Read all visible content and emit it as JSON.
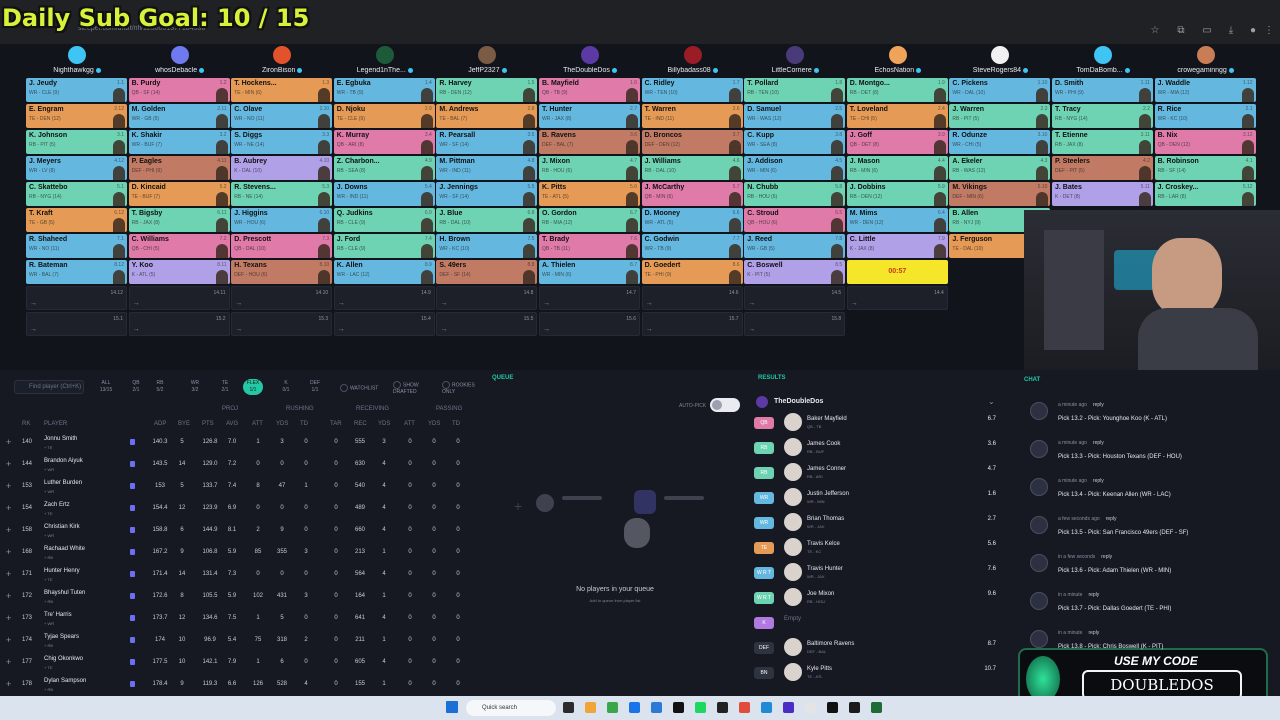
{
  "overlay": {
    "sub_goal": "Daily Sub Goal:  10 / 15"
  },
  "browser": {
    "url": "sleeper.com/draft/nfl/1250001377184536"
  },
  "teams": [
    {
      "name": "Nighthawkgg",
      "color": "#3ec5f3"
    },
    {
      "name": "whosDebacle",
      "color": "#6f79f0"
    },
    {
      "name": "ZironBison",
      "color": "#e2522b"
    },
    {
      "name": "Legend1nThe...",
      "color": "#1d5a3a"
    },
    {
      "name": "JeffP2327",
      "color": "#7a5b44"
    },
    {
      "name": "TheDoubleDos",
      "color": "#5c3aa6"
    },
    {
      "name": "Billybadass08",
      "color": "#9a1c24"
    },
    {
      "name": "LittleCorriere",
      "color": "#4a3a7a"
    },
    {
      "name": "EchosNation",
      "color": "#f0a45a"
    },
    {
      "name": "SteveRogers84",
      "color": "#f1f1f1"
    },
    {
      "name": "TomDaBomb...",
      "color": "#3ec5f3"
    },
    {
      "name": "crowegaminngg",
      "color": "#c87d55"
    }
  ],
  "board": [
    [
      [
        "J. Jeudy",
        "WR - CLE (9)",
        "1.1",
        "WR"
      ],
      [
        "B. Purdy",
        "QB - SF (14)",
        "1.2",
        "QB"
      ],
      [
        "T. Hockens...",
        "TE - MIN (6)",
        "1.3",
        "TE"
      ],
      [
        "E. Egbuka",
        "WR - TB (9)",
        "1.4",
        "WR"
      ],
      [
        "R. Harvey",
        "RB - DEN (12)",
        "1.5",
        "RB"
      ],
      [
        "B. Mayfield",
        "QB - TB (9)",
        "1.6",
        "QB"
      ],
      [
        "C. Ridley",
        "WR - TEN (10)",
        "1.7",
        "WR"
      ],
      [
        "T. Pollard",
        "RB - TEN (10)",
        "1.8",
        "RB"
      ],
      [
        "D. Montgo...",
        "RB - DET (8)",
        "1.9",
        "RB"
      ],
      [
        "C. Pickens",
        "WR - DAL (10)",
        "1.10",
        "WR"
      ],
      [
        "D. Smith",
        "WR - PHI (9)",
        "1.11",
        "WR"
      ],
      [
        "J. Waddle",
        "WR - MIA (12)",
        "1.12",
        "WR"
      ]
    ],
    [
      [
        "E. Engram",
        "TE - DEN (12)",
        "2.12",
        "TE"
      ],
      [
        "M. Golden",
        "WR - GB (5)",
        "2.11",
        "WR"
      ],
      [
        "C. Olave",
        "WR - NO (11)",
        "2.10",
        "WR"
      ],
      [
        "D. Njoku",
        "TE - CLE (9)",
        "2.9",
        "TE"
      ],
      [
        "M. Andrews",
        "TE - BAL (7)",
        "2.8",
        "TE"
      ],
      [
        "T. Hunter",
        "WR - JAX (8)",
        "2.7",
        "WR"
      ],
      [
        "T. Warren",
        "TE - IND (11)",
        "2.6",
        "TE"
      ],
      [
        "D. Samuel",
        "WR - WAS (12)",
        "2.5",
        "WR"
      ],
      [
        "T. Loveland",
        "TE - CHI (5)",
        "2.4",
        "TE"
      ],
      [
        "J. Warren",
        "RB - PIT (5)",
        "2.3",
        "RB"
      ],
      [
        "T. Tracy",
        "RB - NYG (14)",
        "2.2",
        "RB"
      ],
      [
        "R. Rice",
        "WR - KC (10)",
        "2.1",
        "WR"
      ]
    ],
    [
      [
        "K. Johnson",
        "RB - PIT (5)",
        "3.1",
        "RB"
      ],
      [
        "K. Shakir",
        "WR - BUF (7)",
        "3.2",
        "WR"
      ],
      [
        "S. Diggs",
        "WR - NE (14)",
        "3.3",
        "WR"
      ],
      [
        "K. Murray",
        "QB - ARI (8)",
        "3.4",
        "QB"
      ],
      [
        "R. Pearsall",
        "WR - SF (14)",
        "3.5",
        "WR"
      ],
      [
        "B. Ravens",
        "DEF - BAL (7)",
        "3.6",
        "DEF"
      ],
      [
        "D. Broncos",
        "DEF - DEN (12)",
        "3.7",
        "DEF"
      ],
      [
        "C. Kupp",
        "WR - SEA (8)",
        "3.8",
        "WR"
      ],
      [
        "J. Goff",
        "QB - DET (8)",
        "3.9",
        "QB"
      ],
      [
        "R. Odunze",
        "WR - CHI (5)",
        "3.10",
        "WR"
      ],
      [
        "T. Etienne",
        "RB - JAX (8)",
        "3.11",
        "RB"
      ],
      [
        "B. Nix",
        "QB - DEN (12)",
        "3.12",
        "QB"
      ]
    ],
    [
      [
        "J. Meyers",
        "WR - LV (8)",
        "4.12",
        "WR"
      ],
      [
        "P. Eagles",
        "DEF - PHI (9)",
        "4.11",
        "DEF"
      ],
      [
        "B. Aubrey",
        "K - DAL (10)",
        "4.10",
        "K"
      ],
      [
        "Z. Charbon...",
        "RB - SEA (8)",
        "4.9",
        "RB"
      ],
      [
        "M. Pittman",
        "WR - IND (11)",
        "4.8",
        "WR"
      ],
      [
        "J. Mixon",
        "RB - HOU (6)",
        "4.7",
        "RB"
      ],
      [
        "J. Williams",
        "RB - DAL (10)",
        "4.6",
        "RB"
      ],
      [
        "J. Addison",
        "WR - MIN (6)",
        "4.5",
        "WR"
      ],
      [
        "J. Mason",
        "RB - MIN (6)",
        "4.4",
        "RB"
      ],
      [
        "A. Ekeler",
        "RB - WAS (12)",
        "4.3",
        "RB"
      ],
      [
        "P. Steelers",
        "DEF - PIT (5)",
        "4.2",
        "DEF"
      ],
      [
        "B. Robinson",
        "RB - SF (14)",
        "4.1",
        "RB"
      ]
    ],
    [
      [
        "C. Skattebo",
        "RB - NYG (14)",
        "5.1",
        "RB"
      ],
      [
        "D. Kincaid",
        "TE - BUF (7)",
        "5.2",
        "TE"
      ],
      [
        "R. Stevens...",
        "RB - NE (14)",
        "5.3",
        "RB"
      ],
      [
        "J. Downs",
        "WR - IND (11)",
        "5.4",
        "WR"
      ],
      [
        "J. Jennings",
        "WR - SF (14)",
        "5.5",
        "WR"
      ],
      [
        "K. Pitts",
        "TE - ATL (5)",
        "5.6",
        "TE"
      ],
      [
        "J. McCarthy",
        "QB - MIN (6)",
        "5.7",
        "QB"
      ],
      [
        "N. Chubb",
        "RB - HOU (6)",
        "5.8",
        "RB"
      ],
      [
        "J. Dobbins",
        "RB - DEN (12)",
        "5.9",
        "RB"
      ],
      [
        "M. Vikings",
        "DEF - MIN (6)",
        "5.10",
        "DEF"
      ],
      [
        "J. Bates",
        "K - DET (8)",
        "5.11",
        "K"
      ],
      [
        "J. Croskey...",
        "RB - LAR (8)",
        "5.12",
        "RB"
      ]
    ],
    [
      [
        "T. Kraft",
        "TE - GB (5)",
        "6.12",
        "TE"
      ],
      [
        "T. Bigsby",
        "RB - JAX (8)",
        "6.11",
        "RB"
      ],
      [
        "J. Higgins",
        "WR - HOU (6)",
        "6.10",
        "WR"
      ],
      [
        "Q. Judkins",
        "RB - CLE (9)",
        "6.9",
        "RB"
      ],
      [
        "J. Blue",
        "RB - DAL (10)",
        "6.8",
        "RB"
      ],
      [
        "O. Gordon",
        "RB - MIA (12)",
        "6.7",
        "RB"
      ],
      [
        "D. Mooney",
        "WR - ATL (5)",
        "6.6",
        "WR"
      ],
      [
        "C. Stroud",
        "QB - HOU (6)",
        "6.5",
        "QB"
      ],
      [
        "M. Mims",
        "WR - DEN (12)",
        "6.4",
        "WR"
      ],
      [
        "B. Allen",
        "RB - NYJ (9)",
        "6.3",
        "RB"
      ],
      [
        "",
        "",
        "",
        ""
      ],
      [
        "",
        "",
        "",
        ""
      ]
    ],
    [
      [
        "R. Shaheed",
        "WR - NO (11)",
        "7.1",
        "WR"
      ],
      [
        "C. Williams",
        "QB - CHI (5)",
        "7.2",
        "QB"
      ],
      [
        "D. Prescott",
        "QB - DAL (10)",
        "7.3",
        "QB"
      ],
      [
        "J. Ford",
        "RB - CLE (9)",
        "7.4",
        "RB"
      ],
      [
        "H. Brown",
        "WR - KC (10)",
        "7.5",
        "WR"
      ],
      [
        "T. Brady",
        "QB - TB (11)",
        "7.6",
        "QB"
      ],
      [
        "C. Godwin",
        "WR - TB (9)",
        "7.7",
        "WR"
      ],
      [
        "J. Reed",
        "WR - GB (5)",
        "7.8",
        "WR"
      ],
      [
        "C. Little",
        "K - JAX (8)",
        "7.9",
        "K"
      ],
      [
        "J. Ferguson",
        "TE - DAL (10)",
        "7.10",
        "TE"
      ],
      [
        "",
        "",
        "",
        ""
      ],
      [
        "",
        "",
        "",
        ""
      ]
    ],
    [
      [
        "R. Bateman",
        "WR - BAL (7)",
        "8.12",
        "WR"
      ],
      [
        "Y. Koo",
        "K - ATL (5)",
        "8.11",
        "K"
      ],
      [
        "H. Texans",
        "DEF - HOU (6)",
        "8.10",
        "DEF"
      ],
      [
        "K. Allen",
        "WR - LAC (12)",
        "8.9",
        "WR"
      ],
      [
        "S. 49ers",
        "DEF - SF (14)",
        "8.8",
        "DEF"
      ],
      [
        "A. Thielen",
        "WR - MIN (6)",
        "8.7",
        "WR"
      ],
      [
        "D. Goedert",
        "TE - PHI (9)",
        "8.6",
        "TE"
      ],
      [
        "C. Boswell",
        "K - PIT (5)",
        "8.5",
        "K"
      ],
      [
        "",
        "",
        "",
        ""
      ],
      [
        "",
        "",
        "",
        ""
      ],
      [
        "",
        "",
        "",
        ""
      ],
      [
        "",
        "",
        "",
        ""
      ]
    ]
  ],
  "timer": "00:57",
  "empty_row9": [
    "14.12",
    "14.11",
    "14.10",
    "14.9",
    "14.8",
    "14.7",
    "14.6",
    "14.5",
    "14.4"
  ],
  "empty_row10": [
    "15.1",
    "15.2",
    "15.3",
    "15.4",
    "15.5",
    "15.6",
    "15.7",
    "15.8"
  ],
  "player_list": {
    "search_placeholder": "Find player (Ctrl+K)",
    "positions": [
      [
        "ALL",
        "13/15"
      ],
      [
        "QB",
        "2/1"
      ],
      [
        "RB",
        "5/2"
      ],
      [
        "WR",
        "3/2"
      ],
      [
        "TE",
        "2/1"
      ],
      [
        "FLEX",
        "1/1"
      ],
      [
        "K",
        "0/1"
      ],
      [
        "DEF",
        "1/1"
      ]
    ],
    "selected_position": "FLEX",
    "watchlist": "WATCHLIST",
    "show_drafted": "SHOW DRAFTED",
    "rookies_only": "ROOKIES ONLY",
    "group_headers": [
      "PROJ",
      "RUSHING",
      "RECEIVING",
      "PASSING"
    ],
    "columns": [
      "RK",
      "PLAYER",
      "ADP",
      "BYE",
      "PTS",
      "AVG",
      "ATT",
      "YDS",
      "TD",
      "TAR",
      "REC",
      "YDS",
      "ATT",
      "YDS",
      "TD"
    ],
    "rows": [
      [
        "140",
        "Jonnu Smith",
        "+ TE",
        "140.3",
        "5",
        "126.8",
        "7.0",
        "1",
        "3",
        "0",
        "0",
        "555",
        "3",
        "0",
        "0",
        "0"
      ],
      [
        "144",
        "Brandon Aiyuk",
        "+ WR",
        "143.5",
        "14",
        "129.0",
        "7.2",
        "0",
        "0",
        "0",
        "0",
        "630",
        "4",
        "0",
        "0",
        "0"
      ],
      [
        "153",
        "Luther Burden",
        "+ WR",
        "153",
        "5",
        "133.7",
        "7.4",
        "8",
        "47",
        "1",
        "0",
        "540",
        "4",
        "0",
        "0",
        "0"
      ],
      [
        "154",
        "Zach Ertz",
        "+ TE",
        "154.4",
        "12",
        "123.9",
        "6.9",
        "0",
        "0",
        "0",
        "0",
        "489",
        "4",
        "0",
        "0",
        "0"
      ],
      [
        "158",
        "Christian Kirk",
        "+ WR",
        "158.8",
        "6",
        "144.9",
        "8.1",
        "2",
        "9",
        "0",
        "0",
        "660",
        "4",
        "0",
        "0",
        "0"
      ],
      [
        "168",
        "Rachaad White",
        "+ RB",
        "167.2",
        "9",
        "106.8",
        "5.9",
        "85",
        "355",
        "3",
        "0",
        "213",
        "1",
        "0",
        "0",
        "0"
      ],
      [
        "171",
        "Hunter Henry",
        "+ TE",
        "171.4",
        "14",
        "131.4",
        "7.3",
        "0",
        "0",
        "0",
        "0",
        "564",
        "4",
        "0",
        "0",
        "0"
      ],
      [
        "172",
        "Bhayshul Tuten",
        "+ RB",
        "172.6",
        "8",
        "105.5",
        "5.9",
        "102",
        "431",
        "3",
        "0",
        "164",
        "1",
        "0",
        "0",
        "0"
      ],
      [
        "173",
        "Tre' Harris",
        "+ WR",
        "173.7",
        "12",
        "134.6",
        "7.5",
        "1",
        "5",
        "0",
        "0",
        "641",
        "4",
        "0",
        "0",
        "0"
      ],
      [
        "174",
        "Tyjae Spears",
        "+ RB",
        "174",
        "10",
        "96.9",
        "5.4",
        "75",
        "318",
        "2",
        "0",
        "211",
        "1",
        "0",
        "0",
        "0"
      ],
      [
        "177",
        "Chig Okonkwo",
        "+ TE",
        "177.5",
        "10",
        "142.1",
        "7.9",
        "1",
        "6",
        "0",
        "0",
        "605",
        "4",
        "0",
        "0",
        "0"
      ],
      [
        "178",
        "Dylan Sampson",
        "+ RB",
        "178.4",
        "9",
        "119.3",
        "6.6",
        "126",
        "528",
        "4",
        "0",
        "155",
        "1",
        "0",
        "0",
        "0"
      ]
    ]
  },
  "queue": {
    "title": "QUEUE",
    "autopick": "AUTO-PICK",
    "empty_title": "No players in your queue",
    "empty_sub": "Add to queue from player list"
  },
  "results": {
    "title": "RESULTS",
    "team": "TheDoubleDos",
    "rows": [
      [
        "QB",
        "Baker Mayfield",
        "QB - TB",
        "6.7",
        "#e07aa8"
      ],
      [
        "RB",
        "James Cook",
        "RB - BUF",
        "3.6",
        "#6ed3b2"
      ],
      [
        "RB",
        "James Conner",
        "RB - ARI",
        "4.7",
        "#6ed3b2"
      ],
      [
        "WR",
        "Justin Jefferson",
        "WR - MIN",
        "1.6",
        "#64b8e0"
      ],
      [
        "WR",
        "Brian Thomas",
        "WR - JAX",
        "2.7",
        "#64b8e0"
      ],
      [
        "TE",
        "Travis Kelce",
        "TE - KC",
        "5.6",
        "#e59a55"
      ],
      [
        "W R T",
        "Travis Hunter",
        "WR - JAX",
        "7.6",
        "#64b8e0"
      ],
      [
        "W R T",
        "Joe Mixon",
        "RB - HOU",
        "9.6",
        "#6ed3b2"
      ],
      [
        "K",
        "Empty",
        "",
        "",
        "#b07ae0"
      ],
      [
        "DEF",
        "Baltimore Ravens",
        "DEF - BAL",
        "8.7",
        "#2e3340"
      ],
      [
        "BN",
        "Kyle Pitts",
        "TE - ATL",
        "10.7",
        "#2e3340"
      ]
    ]
  },
  "chat": {
    "title": "CHAT",
    "messages": [
      [
        "a minute ago",
        "reply",
        "Pick 13.2 - Pick: Younghoe Koo (K - ATL)"
      ],
      [
        "a minute ago",
        "reply",
        "Pick 13.3 - Pick: Houston Texans (DEF - HOU)"
      ],
      [
        "a minute ago",
        "reply",
        "Pick 13.4 - Pick: Keenan Allen (WR - LAC)"
      ],
      [
        "a few seconds ago",
        "reply",
        "Pick 13.5 - Pick: San Francisco 49ers (DEF - SF)"
      ],
      [
        "in a few seconds",
        "reply",
        "Pick 13.6 - Pick: Adam Thielen (WR - MIN)"
      ],
      [
        "in a minute",
        "reply",
        "Pick 13.7 - Pick: Dallas Goedert (TE - PHI)"
      ],
      [
        "in a minute",
        "reply",
        "Pick 13.8 - Pick: Chris Boswell (K - PIT)"
      ]
    ]
  },
  "promo": {
    "line1": "USE MY CODE",
    "code": "DOUBLEDOS"
  },
  "taskbar": {
    "search": "Quick search"
  }
}
